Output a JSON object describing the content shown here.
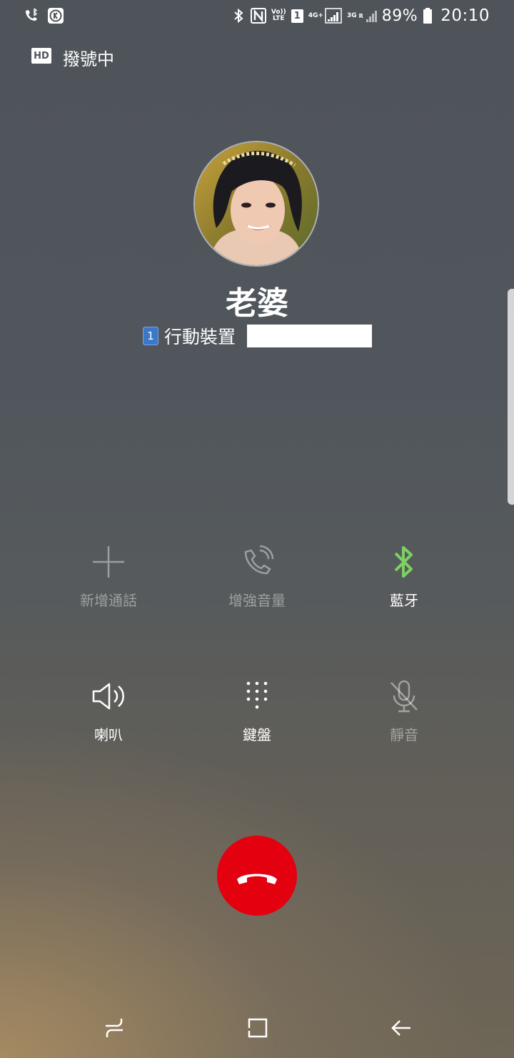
{
  "status_bar": {
    "left_icons": [
      "wifi-call-bluetooth-icon",
      "k-app-icon"
    ],
    "volte_top": "Vo))",
    "volte_bottom": "LTE",
    "sim_number": "1",
    "network_4g": "4G+",
    "network_3g": "3G",
    "network_r": "R",
    "battery_percent": "89%",
    "time": "20:10"
  },
  "call": {
    "hd_label": "HD",
    "state": "撥號中",
    "contact_name": "老婆",
    "sim_badge": "1",
    "number_type": "行動裝置"
  },
  "controls": {
    "add_call": "新增通話",
    "boost_volume": "增強音量",
    "bluetooth": "藍牙",
    "speaker": "喇叭",
    "keypad": "鍵盤",
    "mute": "靜音"
  },
  "colors": {
    "end_call": "#e3000f",
    "bluetooth_active": "#7dd063",
    "sim_badge": "#3b78c7"
  }
}
